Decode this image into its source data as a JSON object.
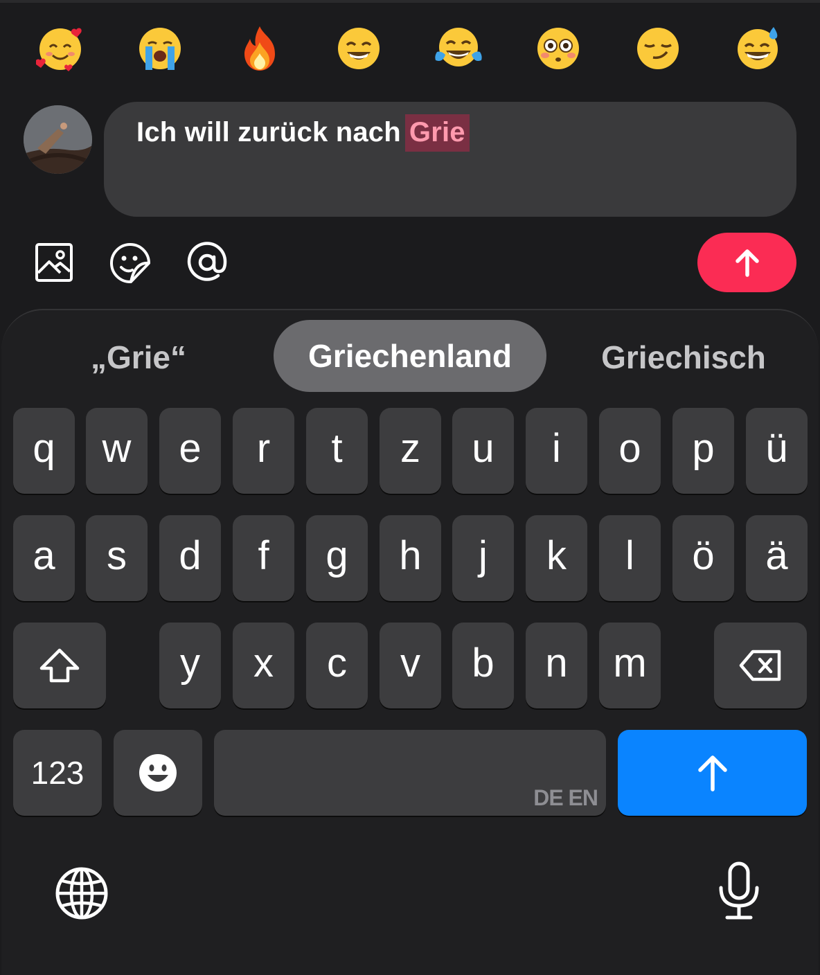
{
  "emoji_bar": {
    "items": [
      {
        "name": "smiling-face-with-hearts"
      },
      {
        "name": "loudly-crying-face"
      },
      {
        "name": "fire"
      },
      {
        "name": "beaming-face"
      },
      {
        "name": "face-with-tears-of-joy"
      },
      {
        "name": "flushed-face"
      },
      {
        "name": "smirking-face"
      },
      {
        "name": "grinning-face-with-sweat"
      }
    ]
  },
  "composer": {
    "text_before": "Ich will zurück nach",
    "marked_text": "Grie"
  },
  "toolbar": {
    "icons": [
      "image-icon",
      "sticker-icon",
      "at-mention-icon"
    ],
    "send_icon": "arrow-up-icon",
    "send_color": "#fb2c54"
  },
  "suggestions": [
    "„Grie“",
    "Griechenland",
    "Griechisch"
  ],
  "keyboard": {
    "row1": [
      "q",
      "w",
      "e",
      "r",
      "t",
      "z",
      "u",
      "i",
      "o",
      "p",
      "ü"
    ],
    "row2": [
      "a",
      "s",
      "d",
      "f",
      "g",
      "h",
      "j",
      "k",
      "l",
      "ö",
      "ä"
    ],
    "row3": [
      "y",
      "x",
      "c",
      "v",
      "b",
      "n",
      "m"
    ],
    "numbers_label": "123",
    "space_languages": "DE EN",
    "return_color": "#0a84ff"
  }
}
